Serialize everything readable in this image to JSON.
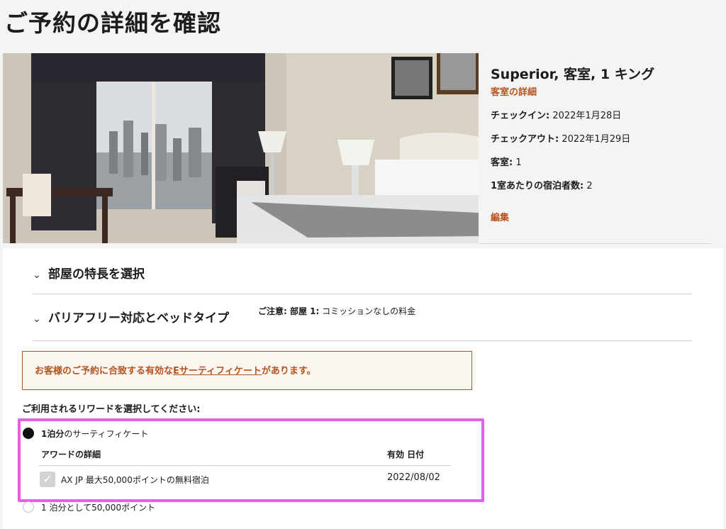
{
  "page": {
    "title": "ご予約の詳細を確認"
  },
  "room": {
    "name": "Superior, 客室, 1 キング",
    "details_link": "客室の詳細",
    "checkin_label": "チェックイン:",
    "checkin_value": " 2022年1月28日",
    "checkout_label": "チェックアウト:",
    "checkout_value": " 2022年1月29日",
    "rooms_label": "客室:",
    "rooms_value": " 1",
    "guests_label": "1室あたりの宿泊者数:",
    "guests_value": " 2",
    "edit_link": "編集"
  },
  "accordions": [
    {
      "title": "部屋の特長を選択",
      "icon": "chevron-down-icon"
    },
    {
      "title": "バリアフリー対応とベッドタイプ",
      "icon": "chevron-down-icon",
      "note_label": "ご注意: 部屋 1:",
      "note_text": " コミッションなしの料金"
    }
  ],
  "certificate_alert": {
    "prefix": "お客様のご予約に合致する有効な",
    "link": "Eサーティフィケート",
    "suffix": "があります。"
  },
  "rewards": {
    "heading": "ご利用されるリワードを選択してください:",
    "options": [
      {
        "bold": "1泊分",
        "text": "のサーティフィケート",
        "selected": true
      },
      {
        "text": "1 泊分として50,000ポイント",
        "selected": false
      }
    ],
    "table": {
      "col_award": "アワードの詳細",
      "col_date": "有効 日付",
      "rows": [
        {
          "name": "AX JP 最大50,000ポイントの無料宿泊",
          "date": "2022/08/02",
          "checked": true
        }
      ]
    }
  },
  "colors": {
    "accent": "#b6531e",
    "highlight": "#e85ee9"
  }
}
